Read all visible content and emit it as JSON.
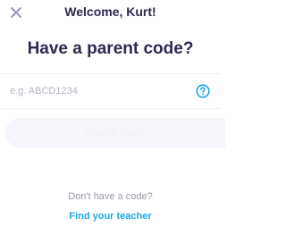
{
  "header": {
    "close_icon": "close-icon",
    "welcome_text": "Welcome, Kurt!"
  },
  "main": {
    "heading": "Have a parent code?",
    "code_input": {
      "placeholder": "e.g. ABCD1234",
      "value": ""
    },
    "help_icon": "question-circle-icon",
    "check_button_label": "Check code",
    "no_code_text": "Don't have a code?",
    "find_teacher_link": "Find your teacher"
  },
  "colors": {
    "heading": "#2c2a50",
    "accent": "#1aa7e8",
    "muted_text": "#9a99ad",
    "placeholder": "#b4b3c4",
    "disabled_button_bg": "#f5f5fb",
    "close_icon": "#9a98c8"
  }
}
